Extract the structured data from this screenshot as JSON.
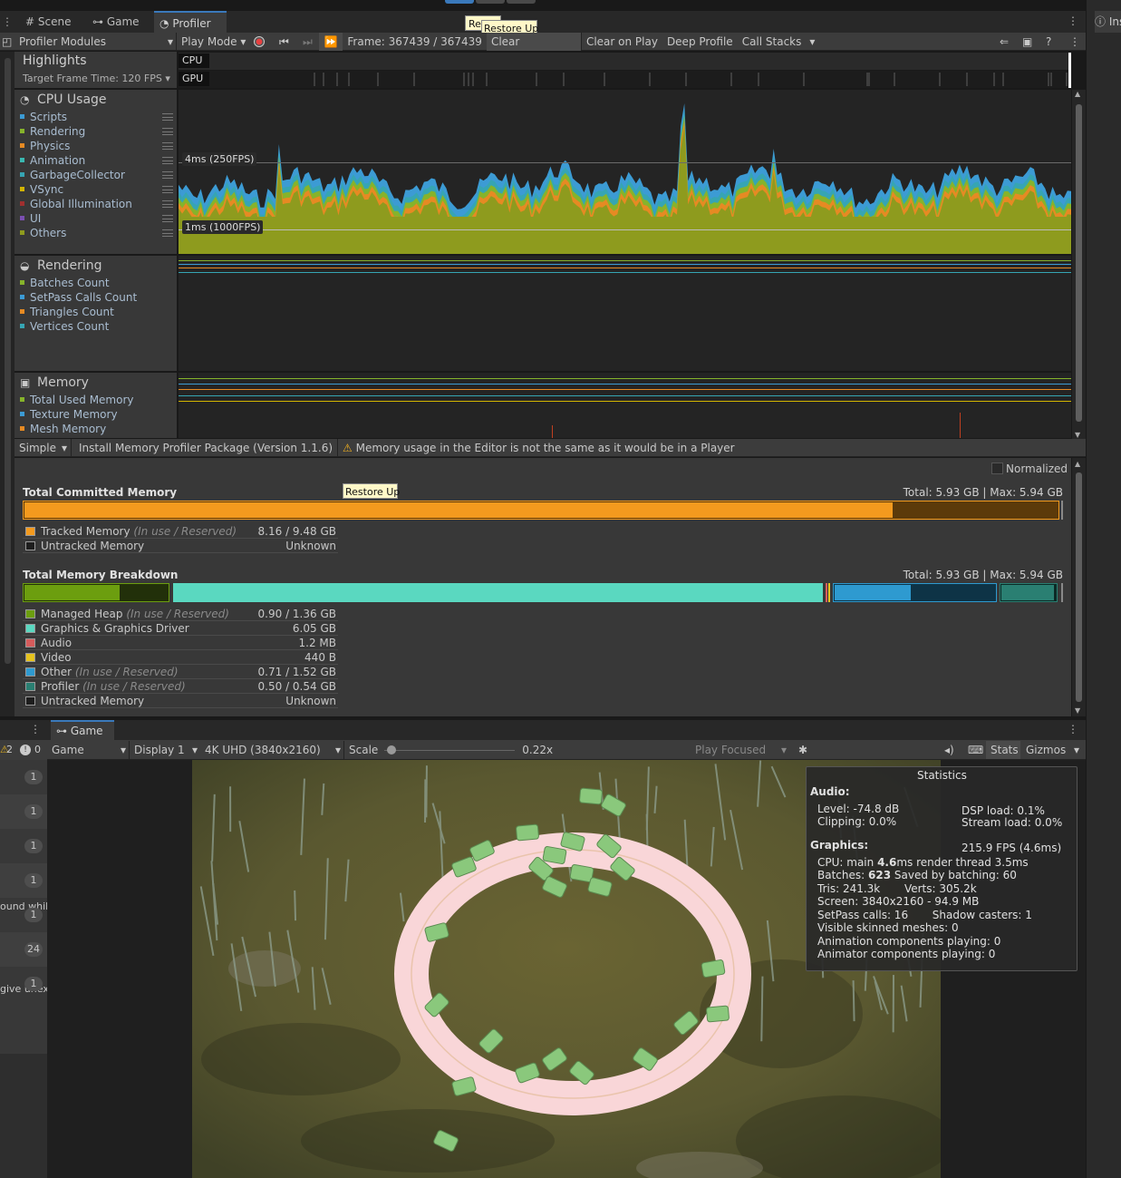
{
  "tabs": {
    "scene": "Scene",
    "game": "Game",
    "profiler": "Profiler",
    "inspector_partial": "Ins"
  },
  "tooltips": {
    "top_partial": "Res",
    "top": "Restore Up",
    "middle": "Restore Up"
  },
  "toolbar": {
    "modules": "Profiler Modules",
    "play_mode": "Play Mode",
    "frame": "Frame: 367439 / 367439",
    "clear": "Clear",
    "clear_on_play": "Clear on Play",
    "deep_profile": "Deep Profile",
    "call_stacks": "Call Stacks"
  },
  "highlights": {
    "title": "Highlights",
    "target": "Target Frame Time: 120 FPS",
    "cpu": "CPU",
    "gpu": "GPU"
  },
  "cpu_module": {
    "title": "CPU Usage",
    "items": [
      {
        "label": "Scripts",
        "color": "#3c9bd4"
      },
      {
        "label": "Rendering",
        "color": "#86b32b"
      },
      {
        "label": "Physics",
        "color": "#e68a23"
      },
      {
        "label": "Animation",
        "color": "#3ab8b0"
      },
      {
        "label": "GarbageCollector",
        "color": "#36a5b3"
      },
      {
        "label": "VSync",
        "color": "#d2b400"
      },
      {
        "label": "Global Illumination",
        "color": "#a02f2f"
      },
      {
        "label": "UI",
        "color": "#7a4fb0"
      },
      {
        "label": "Others",
        "color": "#8e9b1e"
      }
    ],
    "label_4ms": "4ms (250FPS)",
    "label_1ms": "1ms (1000FPS)"
  },
  "rendering_module": {
    "title": "Rendering",
    "items": [
      {
        "label": "Batches Count",
        "color": "#86b32b"
      },
      {
        "label": "SetPass Calls Count",
        "color": "#3c9bd4"
      },
      {
        "label": "Triangles Count",
        "color": "#e68a23"
      },
      {
        "label": "Vertices Count",
        "color": "#36a5b3"
      }
    ]
  },
  "memory_module": {
    "title": "Memory",
    "items": [
      {
        "label": "Total Used Memory",
        "color": "#86b32b"
      },
      {
        "label": "Texture Memory",
        "color": "#3c9bd4"
      },
      {
        "label": "Mesh Memory",
        "color": "#e68a23"
      }
    ]
  },
  "detail_bar": {
    "view": "Simple",
    "install": "Install Memory Profiler Package (Version 1.1.6)",
    "warning": "Memory usage in the Editor is not the same as it would be in a Player",
    "normalized": "Normalized"
  },
  "committed": {
    "title": "Total Committed Memory",
    "totals": "Total: 5.93 GB | Max: 5.94 GB",
    "fill_fraction": 0.84,
    "rows": [
      {
        "label": "Tracked Memory",
        "note": "(In use / Reserved)",
        "value": "8.16 / 9.48 GB",
        "color": "#f39a1e"
      },
      {
        "label": "Untracked Memory",
        "note": "",
        "value": "Unknown",
        "color": "#1e1e1e"
      }
    ]
  },
  "breakdown": {
    "title": "Total Memory Breakdown",
    "totals": "Total: 5.93 GB | Max: 5.94 GB",
    "rows": [
      {
        "label": "Managed Heap",
        "note": "(In use / Reserved)",
        "value": "0.90 / 1.36 GB",
        "color": "#6c9e0f"
      },
      {
        "label": "Graphics & Graphics Driver",
        "note": "",
        "value": "6.05 GB",
        "color": "#5ad8c0"
      },
      {
        "label": "Audio",
        "note": "",
        "value": "1.2 MB",
        "color": "#d65c5c"
      },
      {
        "label": "Video",
        "note": "",
        "value": "440 B",
        "color": "#e6c31e"
      },
      {
        "label": "Other",
        "note": "(In use / Reserved)",
        "value": "0.71 / 1.52 GB",
        "color": "#2e9ad0"
      },
      {
        "label": "Profiler",
        "note": "(In use / Reserved)",
        "value": "0.50 / 0.54 GB",
        "color": "#2a7f72"
      },
      {
        "label": "Untracked Memory",
        "note": "",
        "value": "Unknown",
        "color": "#1e1e1e"
      }
    ]
  },
  "game_panel": {
    "tab": "Game",
    "mode": "Game",
    "display": "Display 1",
    "resolution": "4K UHD (3840x2160)",
    "scale_label": "Scale",
    "scale_value": "0.22x",
    "scale_fraction": 0.02,
    "play_focused": "Play Focused",
    "stats": "Stats",
    "gizmos": "Gizmos"
  },
  "console_partial": {
    "warn_count": "2",
    "err_count": "0",
    "badges": [
      "1",
      "1",
      "1",
      "1",
      "1",
      "24",
      "1"
    ],
    "text_a": "ound whil",
    "text_b": "give unex"
  },
  "statistics": {
    "title": "Statistics",
    "audio_head": "Audio:",
    "level": "Level: -74.8 dB",
    "clipping": "Clipping: 0.0%",
    "dsp": "DSP load: 0.1%",
    "stream": "Stream load: 0.0%",
    "fps": "215.9 FPS (4.6ms)",
    "graphics_head": "Graphics:",
    "cpu_a": "CPU: main ",
    "cpu_b": "4.6",
    "cpu_c": "ms  render thread 3.5ms",
    "batches_a": "Batches: ",
    "batches_b": "623",
    "batches_c": "    Saved by batching: 60",
    "tris": "Tris: 241.3k       Verts: 305.2k",
    "screen": "Screen: 3840x2160 - 94.9 MB",
    "setpass": "SetPass calls: 16       Shadow casters: 1",
    "skinned": "Visible skinned meshes: 0",
    "anim": "Animation components playing: 0",
    "animator": "Animator components playing: 0"
  }
}
